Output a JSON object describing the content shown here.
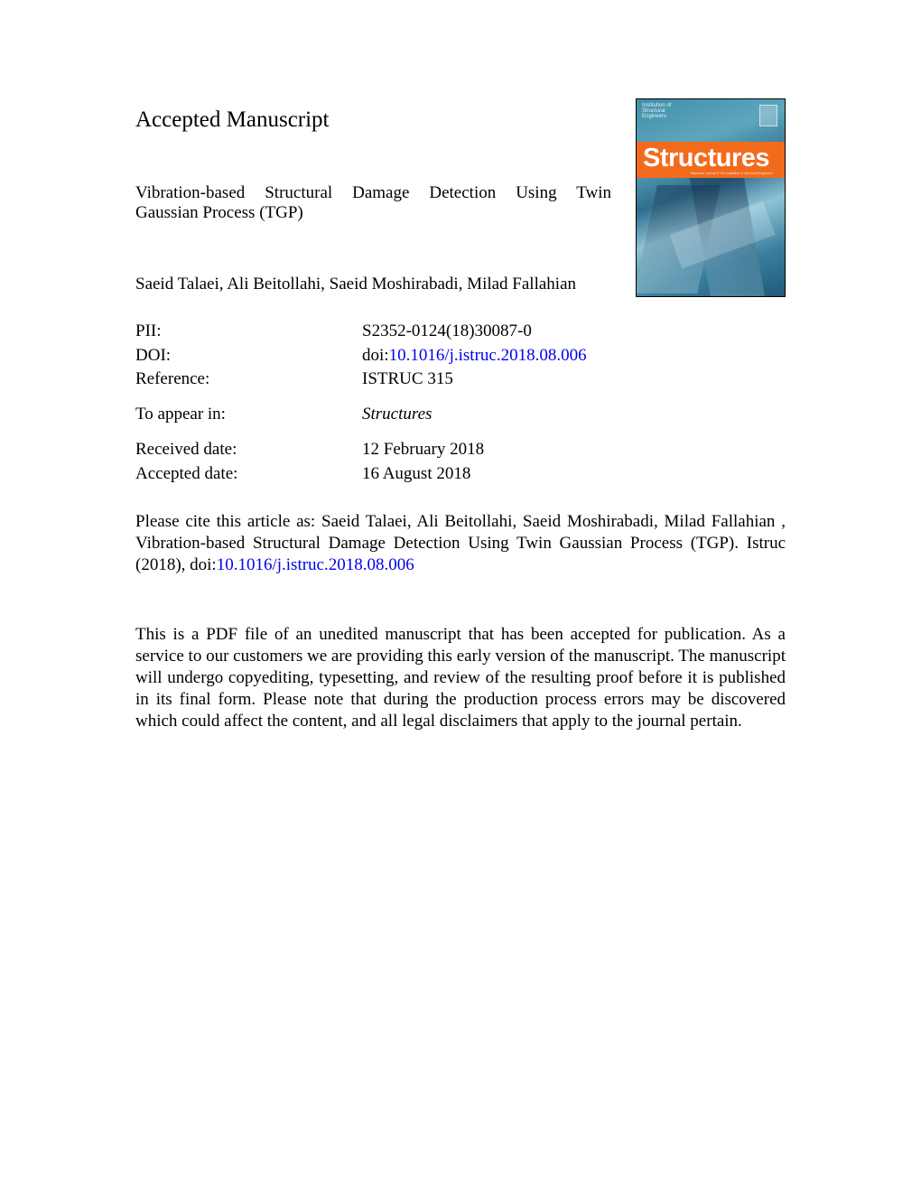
{
  "heading": "Accepted Manuscript",
  "article": {
    "title_line1": "Vibration-based Structural Damage Detection Using Twin",
    "title_line2": "Gaussian Process (TGP)",
    "authors": "Saeid Talaei, Ali Beitollahi, Saeid Moshirabadi, Milad Fallahian"
  },
  "metadata": {
    "pii_label": "PII:",
    "pii_value": "S2352-0124(18)30087-0",
    "doi_label": "DOI:",
    "doi_prefix": "doi:",
    "doi_link": "10.1016/j.istruc.2018.08.006",
    "reference_label": "Reference:",
    "reference_value": "ISTRUC 315",
    "appear_label": "To appear in:",
    "appear_value": "Structures",
    "received_label": "Received date:",
    "received_value": "12 February 2018",
    "accepted_label": "Accepted date:",
    "accepted_value": "16 August 2018"
  },
  "citation": {
    "text": "Please cite this article as: Saeid Talaei, Ali Beitollahi, Saeid Moshirabadi, Milad Fallahian , Vibration-based Structural Damage Detection Using Twin Gaussian Process (TGP). Istruc (2018), doi:",
    "doi_link": "10.1016/j.istruc.2018.08.006"
  },
  "notice": "This is a PDF file of an unedited manuscript that has been accepted for publication. As a service to our customers we are providing this early version of the manuscript. The manuscript will undergo copyediting, typesetting, and review of the resulting proof before it is published in its final form. Please note that during the production process errors may be discovered which could affect the content, and all legal disclaimers that apply to the journal pertain.",
  "cover": {
    "journal_title": "Structures",
    "small_text": "Institution of Structural Engineers",
    "subtitle": "Research Journal of The Institution of Structural Engineers",
    "band_color": "#f26b1d",
    "link_color": "#0000ee"
  }
}
